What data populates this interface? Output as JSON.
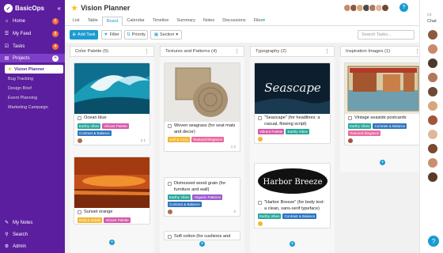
{
  "app": {
    "name": "BasicOps"
  },
  "sidebar": {
    "items": [
      {
        "label": "Home",
        "count": "6"
      },
      {
        "label": "My Feed",
        "count": "8"
      },
      {
        "label": "Tasks",
        "count": "4"
      },
      {
        "label": "Projects"
      }
    ],
    "projects": [
      {
        "label": "Vision Planner"
      },
      {
        "label": "Bug Tracking"
      },
      {
        "label": "Design Brief"
      },
      {
        "label": "Event Planning"
      },
      {
        "label": "Marketing Campaign"
      }
    ],
    "bottom": [
      {
        "label": "My Notes"
      },
      {
        "label": "Search"
      },
      {
        "label": "Admin"
      }
    ]
  },
  "header": {
    "title": "Vision Planner",
    "help": "?"
  },
  "tabs": [
    "List",
    "Table",
    "Board",
    "Calendar",
    "Timeline",
    "Summary",
    "Notes",
    "Discussions",
    "Files"
  ],
  "toolbar": {
    "add": "Add Task",
    "filter": "Filter",
    "priority": "Priority",
    "section": "Section",
    "search_placeholder": "Search Tasks..."
  },
  "columns": [
    {
      "title": "Color Palette",
      "count": "(5)"
    },
    {
      "title": "Textures and Patterns",
      "count": "(4)"
    },
    {
      "title": "Typography",
      "count": "(2)"
    },
    {
      "title": "Inspiration Images",
      "count": "(1)"
    }
  ],
  "cards": {
    "ocean": {
      "title": "Ocean blue",
      "tags": [
        "Earthy Vibes",
        "Vibrant Palette",
        "Contrast & Balance"
      ],
      "meta": "2  1"
    },
    "sunset": {
      "title": "Sunset orange",
      "tags": [
        "Bold & Subtle",
        "Vibrant Palette"
      ]
    },
    "seagrass": {
      "title": "Woven seagrass (for seat mats and decor)",
      "tags": [
        "Soft & Cozy",
        "Textured Elegance"
      ],
      "meta": "1  2"
    },
    "wood": {
      "title": "Distressed wood grain (for furniture and wall)",
      "tags": [
        "Earthy Vibes",
        "Organic Patterns",
        "Contrast & Balance"
      ],
      "meta": "2"
    },
    "cotton": {
      "title": "Soft cotton (for cushions and"
    },
    "seascape": {
      "title": "\"Seascape\" (for headlines: a casual, flowing script)",
      "tags": [
        "Vibrant Palette",
        "Earthy Vibes"
      ],
      "img_text": "Seascape"
    },
    "harbor": {
      "title": "\"Harbor Breeze\" (for body text: a clean, sans-serif typeface)",
      "tags": [
        "Earthy Vibes",
        "Contrast & Balance"
      ],
      "img_text": "Harbor Breeze"
    },
    "postcards": {
      "title": "Vintage seaside postcards",
      "tags": [
        "Earthy Vibes",
        "Contrast & Balance",
        "Textured Elegance"
      ]
    }
  },
  "chat": {
    "label": "Chat"
  },
  "colors": {
    "sidebar": "#5b1e9e",
    "accent": "#1b9bd1",
    "badge": "#f36b3b"
  }
}
